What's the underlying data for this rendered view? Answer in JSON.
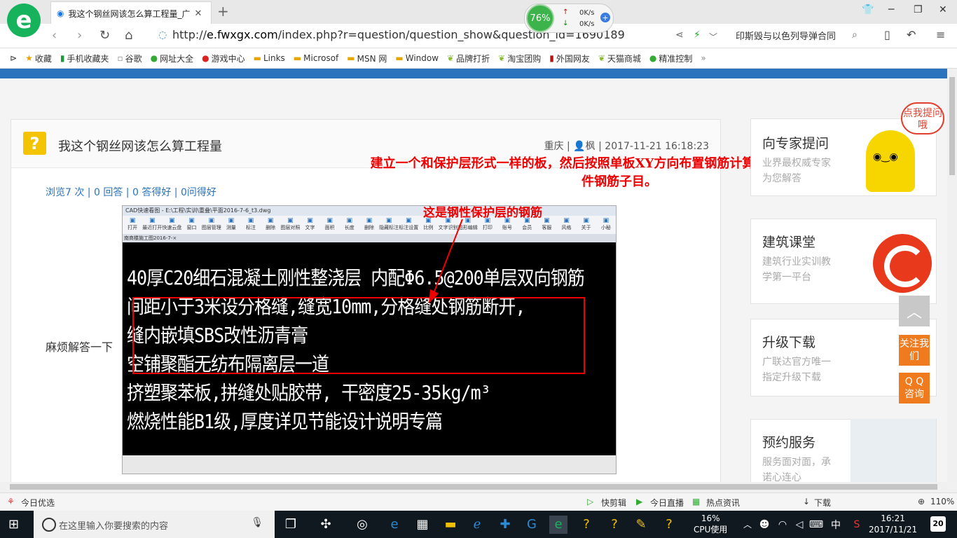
{
  "browser": {
    "tab_title": "我这个钢丝网该怎么算工程量_广",
    "url_prefix": "http://",
    "url_domain": "e.fwxgx.com",
    "url_rest": "/index.php?r=question/question_show&question_id=1690189",
    "search_text": "印斯毁与以色列导弹合同",
    "speed": {
      "percent": "76%",
      "up": "0K/s",
      "down": "0K/s"
    }
  },
  "bookmarks": [
    "收藏",
    "手机收藏夹",
    "谷歌",
    "网址大全",
    "游戏中心",
    "Links",
    "Microsof",
    "MSN 网",
    "Window",
    "品牌打折",
    "淘宝团购",
    "外国网友",
    "天猫商城",
    "精准控制"
  ],
  "question": {
    "title": "我这个钢丝网该怎么算工程量",
    "location": "重庆",
    "user": "枫",
    "date": "2017-11-21 16:18:23",
    "views": "浏览7 次",
    "answers": "0 回答",
    "good": "0 答得好",
    "ask": "0问得好",
    "body": "麻烦解答一下",
    "annotation_main": "建立一个和保护层形式一样的板，然后按照单板XY方向布置钢筋计算钢筋重量，套现浇构件钢筋子目。",
    "annotation_arrow": "这是钢性保护层的钢筋"
  },
  "cad": {
    "title": "CAD快速看图 - E:\\工程\\实训\\重叠\\平面2016-7-6_t3.dwg",
    "tab": "南商楼施工图2016-7-×",
    "ribbon": [
      "打开",
      "最近打开",
      "快速云盘",
      "窗口",
      "图层管理",
      "测量",
      "标注",
      "删除",
      "图层对照",
      "文字",
      "面积",
      "长度",
      "删除",
      "隐藏标注",
      "标注设置",
      "比例",
      "文字识别",
      "图形编辑",
      "打印",
      "账号",
      "会员",
      "客服",
      "风格",
      "关于",
      "小秘"
    ],
    "lines": [
      "40厚C20细石混凝土刚性整浇层      内配Φ6.5@200单层双向钢筋",
      "间距小于3米设分格缝,缝宽10mm,分格缝处钢筋断开,",
      "缝内嵌填SBS改性沥青膏",
      "空铺聚酯无纺布隔离层一道",
      "挤塑聚苯板,拼缝处贴胶带,      干密度25-35kg/m³",
      "燃烧性能B1级,厚度详见节能设计说明专篇"
    ]
  },
  "sidebar": {
    "expert_title": "向专家提问",
    "expert_sub1": "业界最权威专家",
    "expert_sub2": "为您解答",
    "bubble": "点我提问哦",
    "course_title": "建筑课堂",
    "course_sub1": "建筑行业实训教",
    "course_sub2": "学第一平台",
    "upgrade_title": "升级下载",
    "upgrade_sub1": "广联达官方唯一",
    "upgrade_sub2": "指定升级下载",
    "service_title": "预约服务",
    "service_sub1": "服务面对面，承",
    "service_sub2": "诺心连心",
    "follow": "关注我们",
    "qq": "Q Q 咨询"
  },
  "statusbar": {
    "left": "今日优选",
    "items": [
      "快剪辑",
      "今日直播",
      "热点资讯",
      "下载"
    ],
    "zoom": "110%"
  },
  "taskbar": {
    "search_placeholder": "在这里输入你要搜索的内容",
    "cpu_percent": "16%",
    "cpu_label": "CPU使用",
    "time": "16:21",
    "date": "2017/11/21",
    "ime": "中",
    "notifications": "20"
  }
}
